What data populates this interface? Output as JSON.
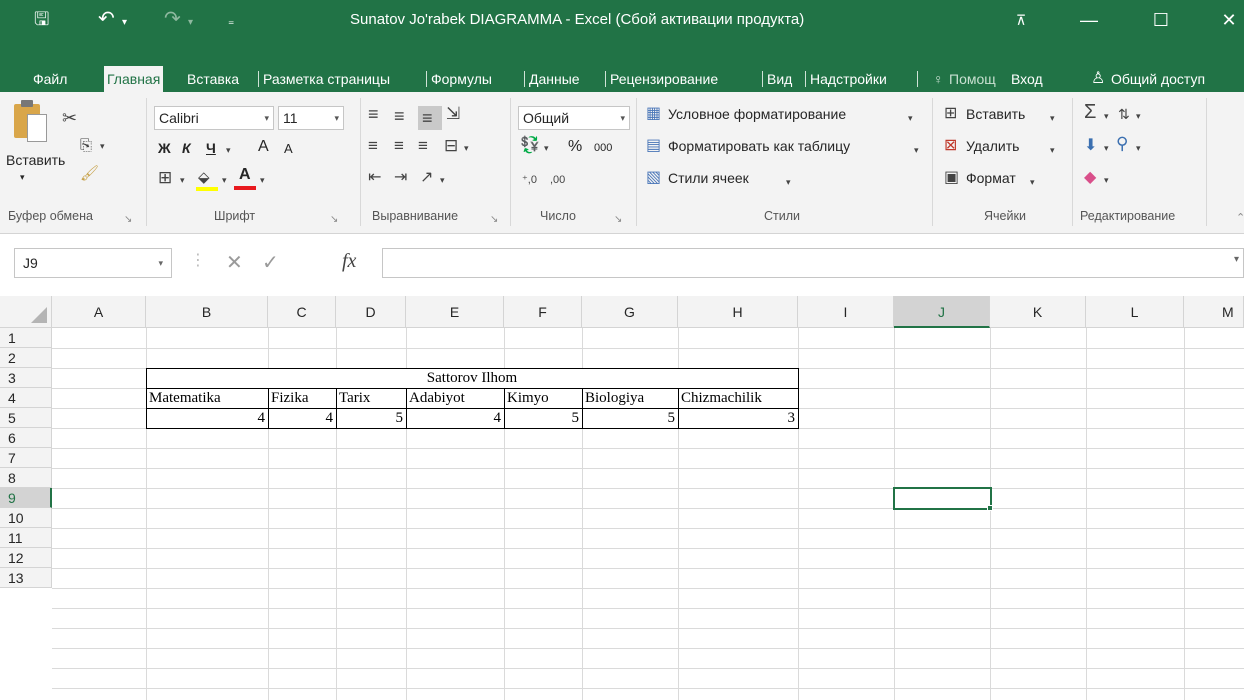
{
  "title": "Sunatov Jo'rabek DIAGRAMMA - Excel (Сбой активации продукта)",
  "window_controls": {
    "ribbon_display": "⊼",
    "minimize": "—",
    "maximize": "☐",
    "close": "✕"
  },
  "tabs": {
    "file": "Файл",
    "home": "Главная",
    "insert": "Вставка",
    "page_layout": "Разметка страницы",
    "formulas": "Формулы",
    "data": "Данные",
    "review": "Рецензирование",
    "view": "Вид",
    "addins": "Надстройки",
    "tell_me": "Помощ",
    "signin": "Вход",
    "share": "Общий доступ"
  },
  "ribbon": {
    "clipboard": {
      "paste": "Вставить",
      "group": "Буфер обмена"
    },
    "font": {
      "name": "Calibri",
      "size": "11",
      "bold": "Ж",
      "italic": "К",
      "underline": "Ч",
      "grow": "A",
      "shrink": "A",
      "font_color_glyph": "A",
      "group": "Шрифт"
    },
    "alignment": {
      "group": "Выравнивание"
    },
    "number": {
      "format": "Общий",
      "percent": "%",
      "thousands": "000",
      "group": "Число"
    },
    "styles": {
      "conditional": "Условное форматирование",
      "as_table": "Форматировать как таблицу",
      "cell_styles": "Стили ячеек",
      "group": "Стили"
    },
    "cells": {
      "insert": "Вставить",
      "delete": "Удалить",
      "format": "Формат",
      "group": "Ячейки"
    },
    "editing": {
      "group": "Редактирование"
    }
  },
  "formula_bar": {
    "name_box": "J9",
    "fx": "fx",
    "value": ""
  },
  "columns": [
    "A",
    "B",
    "C",
    "D",
    "E",
    "F",
    "G",
    "H",
    "I",
    "J",
    "K",
    "L",
    "M"
  ],
  "rows": [
    "1",
    "2",
    "3",
    "4",
    "5",
    "6",
    "7",
    "8",
    "9",
    "10",
    "11",
    "12",
    "13"
  ],
  "selected_cell": "J9",
  "sheet": {
    "title_row": "Sattorov Ilhom",
    "subjects": [
      "Matematika",
      "Fizika",
      "Tarix",
      "Adabiyot",
      "Kimyo",
      "Biologiya",
      "Chizmachilik"
    ],
    "grades": [
      "4",
      "4",
      "5",
      "4",
      "5",
      "5",
      "3"
    ]
  },
  "colors": {
    "excel_green": "#217346",
    "ribbon_bg": "#f3f3f3"
  }
}
